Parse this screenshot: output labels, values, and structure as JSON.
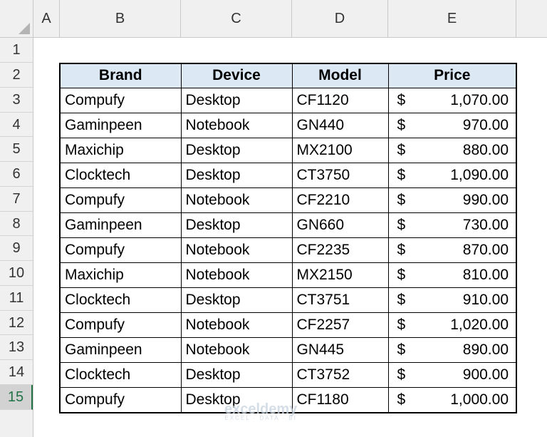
{
  "columns": [
    "A",
    "B",
    "C",
    "D",
    "E"
  ],
  "rows": [
    "1",
    "2",
    "3",
    "4",
    "5",
    "6",
    "7",
    "8",
    "9",
    "10",
    "11",
    "12",
    "13",
    "14",
    "15"
  ],
  "selected_row": "15",
  "table": {
    "headers": [
      "Brand",
      "Device",
      "Model",
      "Price"
    ],
    "currency_symbol": "$",
    "records": [
      {
        "brand": "Compufy",
        "device": "Desktop",
        "model": "CF1120",
        "price": "1,070.00"
      },
      {
        "brand": "Gaminpeen",
        "device": "Notebook",
        "model": "GN440",
        "price": "970.00"
      },
      {
        "brand": "Maxichip",
        "device": "Desktop",
        "model": "MX2100",
        "price": "880.00"
      },
      {
        "brand": "Clocktech",
        "device": "Desktop",
        "model": "CT3750",
        "price": "1,090.00"
      },
      {
        "brand": "Compufy",
        "device": "Notebook",
        "model": "CF2210",
        "price": "990.00"
      },
      {
        "brand": "Gaminpeen",
        "device": "Desktop",
        "model": "GN660",
        "price": "730.00"
      },
      {
        "brand": "Compufy",
        "device": "Notebook",
        "model": "CF2235",
        "price": "870.00"
      },
      {
        "brand": "Maxichip",
        "device": "Notebook",
        "model": "MX2150",
        "price": "810.00"
      },
      {
        "brand": "Clocktech",
        "device": "Desktop",
        "model": "CT3751",
        "price": "910.00"
      },
      {
        "brand": "Compufy",
        "device": "Notebook",
        "model": "CF2257",
        "price": "1,020.00"
      },
      {
        "brand": "Gaminpeen",
        "device": "Notebook",
        "model": "GN445",
        "price": "890.00"
      },
      {
        "brand": "Clocktech",
        "device": "Desktop",
        "model": "CT3752",
        "price": "900.00"
      },
      {
        "brand": "Compufy",
        "device": "Desktop",
        "model": "CF1180",
        "price": "1,000.00"
      }
    ]
  },
  "watermark": {
    "name": "exceldemy",
    "tagline": "EXCEL · DATA · BI"
  },
  "colors": {
    "header_fill": "#dce9f5",
    "selected_row_accent": "#217346",
    "header_bar": "#f0f0f0"
  }
}
